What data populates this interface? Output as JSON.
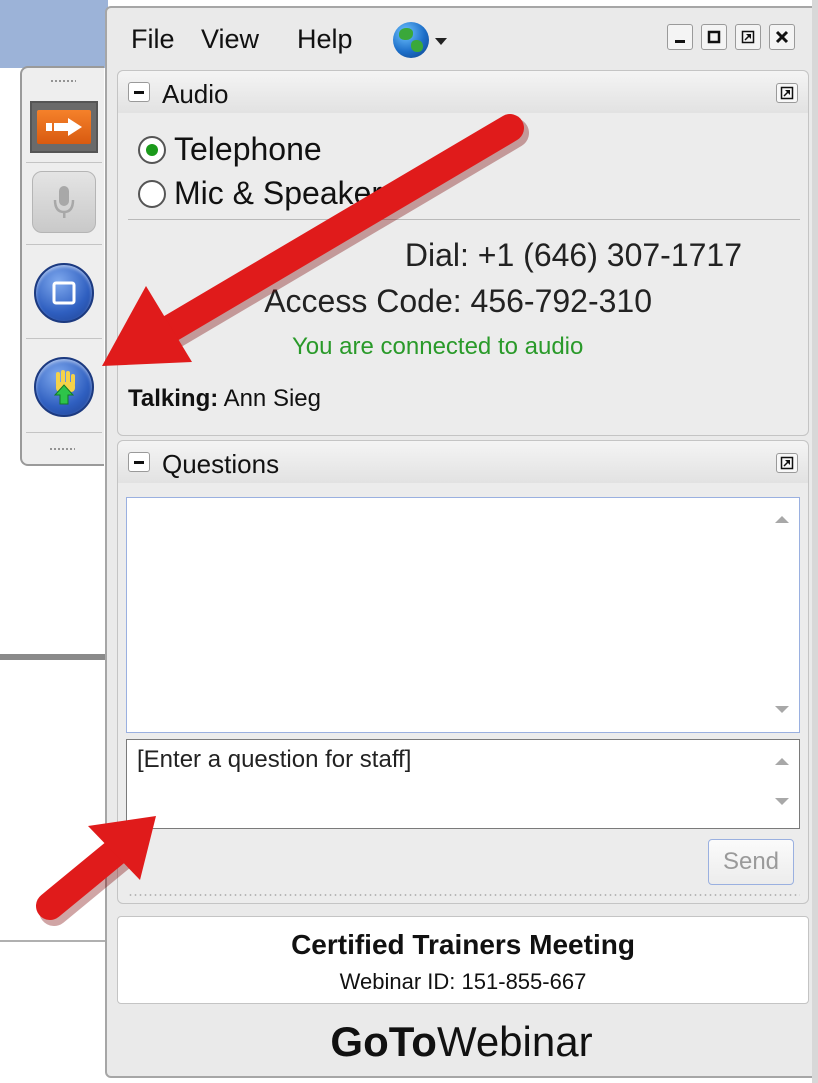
{
  "menu": {
    "file": "File",
    "view": "View",
    "help": "Help"
  },
  "audio": {
    "title": "Audio",
    "options": [
      "Telephone",
      "Mic & Speakers"
    ],
    "selected": "Telephone",
    "dial": "Dial: +1 (646) 307-1717",
    "access_code": "Access Code: 456-792-310",
    "status": "You are connected to audio",
    "talking_label": "Talking:",
    "talking_name": "Ann Sieg"
  },
  "questions": {
    "title": "Questions",
    "placeholder": "[Enter a question for staff]",
    "send_label": "Send"
  },
  "webinar": {
    "title": "Certified Trainers Meeting",
    "id_line": "Webinar ID: 151-855-667"
  },
  "brand": {
    "bold": "GoTo",
    "light": "Webinar"
  },
  "colors": {
    "connected": "#2a9a2a",
    "arrow": "#e01b1b",
    "accent_orange": "#f07020"
  }
}
